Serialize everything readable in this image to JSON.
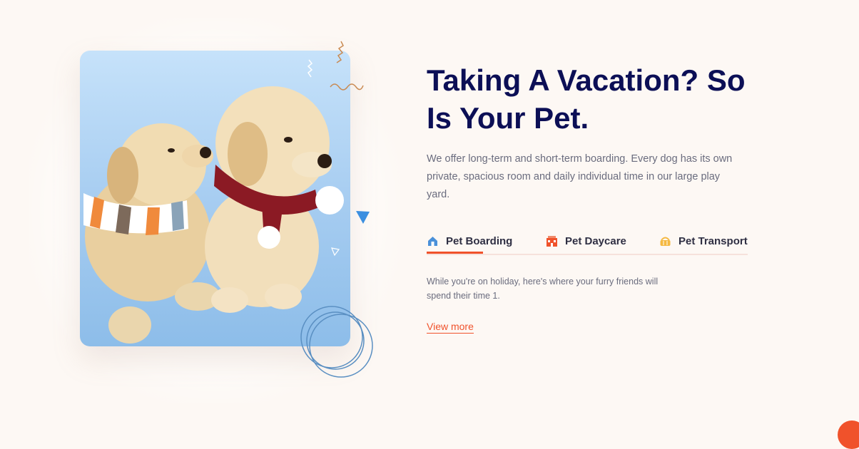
{
  "hero": {
    "heading": "Taking A Vacation? So Is Your Pet.",
    "intro": "We offer long-term and short-term boarding. Every dog has its own private, spacious room and daily individual time in our large play yard.",
    "image": {
      "icon": "puppies-photo",
      "subject": "two puppies wearing scarves"
    }
  },
  "tabs": {
    "active_index": 0,
    "items": [
      {
        "label": "Pet Boarding",
        "icon": "house-icon",
        "color": "#4a90d9"
      },
      {
        "label": "Pet Daycare",
        "icon": "building-icon",
        "color": "#f0522b"
      },
      {
        "label": "Pet Transport",
        "icon": "basket-icon",
        "color": "#f5b942"
      }
    ]
  },
  "tab_content": {
    "text": "While you're on holiday, here's where your furry friends will spend their time 1.",
    "link_label": "View more"
  },
  "colors": {
    "background": "#fdf8f4",
    "heading": "#0c0f56",
    "accent": "#f0522b",
    "photo_bg": "#a7cdf1",
    "deco_blue": "#3b8fe0",
    "deco_brown": "#c98a52"
  },
  "scroll_top": {
    "icon": "arrow-up-icon"
  }
}
